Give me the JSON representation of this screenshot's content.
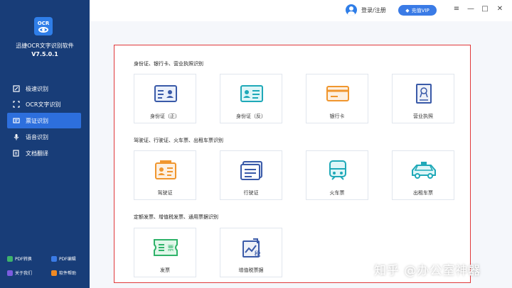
{
  "app": {
    "logo_text": "OCR",
    "name": "迅捷OCR文字识别软件",
    "version": "V7.5.0.1"
  },
  "sidebar": {
    "items": [
      {
        "label": "极速识别",
        "icon": "lightning-icon",
        "active": false
      },
      {
        "label": "OCR文字识别",
        "icon": "ocr-scan-icon",
        "active": false
      },
      {
        "label": "票证识别",
        "icon": "ticket-icon",
        "active": true
      },
      {
        "label": "语音识别",
        "icon": "microphone-icon",
        "active": false
      },
      {
        "label": "文档翻译",
        "icon": "translate-icon",
        "active": false
      }
    ],
    "bottom_links": [
      {
        "label": "PDF转换",
        "icon": "pdf-convert-icon",
        "color": "#3db36b"
      },
      {
        "label": "PDF编辑",
        "icon": "pdf-edit-icon",
        "color": "#3a7be6"
      },
      {
        "label": "关于我们",
        "icon": "about-icon",
        "color": "#7b5ce0"
      },
      {
        "label": "软件帮助",
        "icon": "help-icon",
        "color": "#f08a24"
      }
    ]
  },
  "topbar": {
    "login_label": "登录/注册",
    "vip_label": "充值VIP",
    "window_controls": [
      "≡",
      "—",
      "□",
      "✕"
    ]
  },
  "sections": [
    {
      "title": "身份证、银行卡、营业执照识别",
      "cards": [
        {
          "label": "身份证（正）",
          "icon": "id-card-front-icon"
        },
        {
          "label": "身份证（反）",
          "icon": "id-card-back-icon"
        },
        {
          "label": "银行卡",
          "icon": "bank-card-icon"
        },
        {
          "label": "营业执照",
          "icon": "business-license-icon"
        }
      ]
    },
    {
      "title": "驾驶证、行驶证、火车票、出租车票识别",
      "cards": [
        {
          "label": "驾驶证",
          "icon": "driver-license-icon"
        },
        {
          "label": "行驶证",
          "icon": "vehicle-license-icon"
        },
        {
          "label": "火车票",
          "icon": "train-ticket-icon"
        },
        {
          "label": "出租车票",
          "icon": "taxi-ticket-icon"
        }
      ]
    },
    {
      "title": "定额发票、增值税发票、通用票据识别",
      "cards": [
        {
          "label": "发票",
          "icon": "invoice-icon",
          "icon_text": "票"
        },
        {
          "label": "增值税票据",
          "icon": "vat-invoice-icon",
          "icon_text": "税"
        }
      ]
    }
  ],
  "watermark": "知乎 @办公室神器",
  "colors": {
    "sidebar_bg": "#183d78",
    "active_nav": "#2d6fdd",
    "accent": "#3a7be6",
    "highlight_border": "#e0383a"
  }
}
